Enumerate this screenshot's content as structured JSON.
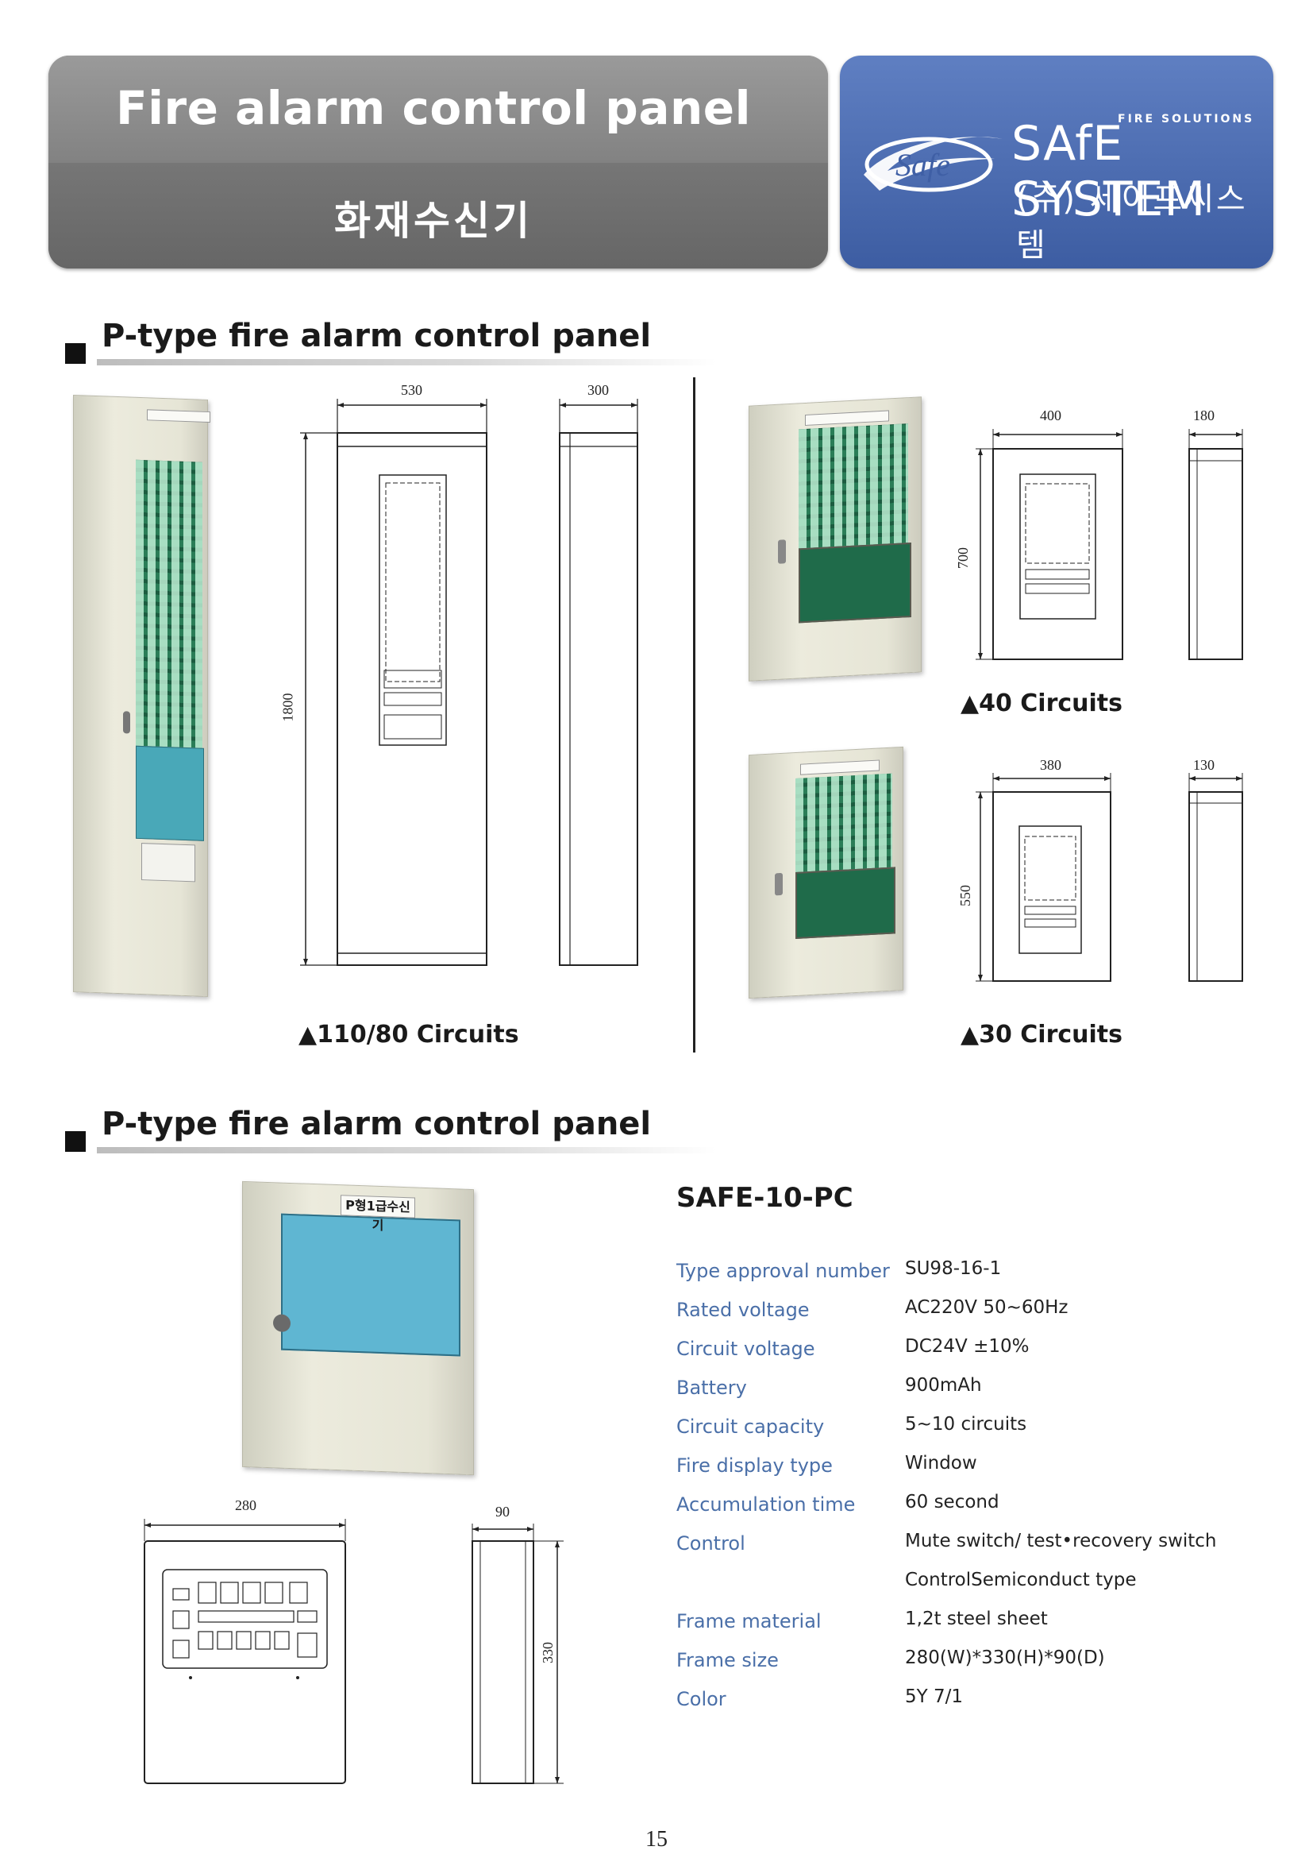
{
  "header": {
    "title_en": "Fire alarm control panel",
    "title_ko": "화재수신기",
    "logo_badge": "Safe",
    "brand_tagline": "FIRE SOLUTIONS",
    "brand_name": "SAfE SYSTEM",
    "brand_korean": "(주) 세이프씨스템"
  },
  "section1": {
    "title": "P-type fire alarm control panel",
    "large": {
      "caption": "▲110/80 Circuits",
      "dim_width": "530",
      "dim_depth": "300",
      "dim_height": "1800"
    },
    "medium": {
      "caption": "▲40 Circuits",
      "dim_width": "400",
      "dim_depth": "180",
      "dim_height": "700"
    },
    "small": {
      "caption": "▲30 Circuits",
      "dim_width": "380",
      "dim_depth": "130",
      "dim_height": "550"
    }
  },
  "section2": {
    "title": "P-type fire alarm control panel",
    "unit_label": "P형1급수신기",
    "model": "SAFE-10-PC",
    "dim_width": "280",
    "dim_depth": "90",
    "dim_height": "330",
    "specs": [
      {
        "label": "Type approval number",
        "value": "SU98-16-1"
      },
      {
        "label": "Rated voltage",
        "value": "AC220V 50~60Hz"
      },
      {
        "label": "Circuit voltage",
        "value": "DC24V ±10%"
      },
      {
        "label": "Battery",
        "value": "900mAh"
      },
      {
        "label": "Circuit capacity",
        "value": "5~10 circuits"
      },
      {
        "label": "Fire display type",
        "value": "Window"
      },
      {
        "label": "Accumulation time",
        "value": "60 second"
      },
      {
        "label": "Control",
        "value": "Mute switch/ test•recovery switch"
      },
      {
        "label": "",
        "value": "ControlSemiconduct type"
      },
      {
        "label": "Frame material",
        "value": "1,2t steel sheet"
      },
      {
        "label": "Frame size",
        "value": "280(W)*330(H)*90(D)"
      },
      {
        "label": "Color",
        "value": "5Y 7/1"
      }
    ]
  },
  "page_number": "15"
}
